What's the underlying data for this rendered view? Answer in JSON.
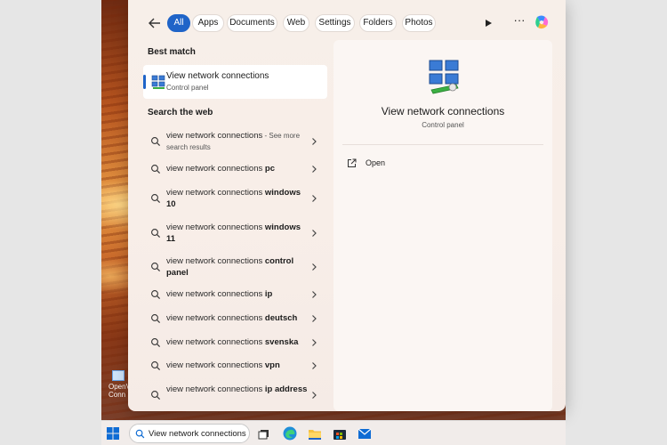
{
  "filters": {
    "back": "back-arrow-icon",
    "chips": [
      {
        "label": "All",
        "active": true
      },
      {
        "label": "Apps"
      },
      {
        "label": "Documents"
      },
      {
        "label": "Web"
      },
      {
        "label": "Settings"
      },
      {
        "label": "Folders"
      },
      {
        "label": "Photos"
      }
    ],
    "more": "···"
  },
  "best_match": {
    "heading": "Best match",
    "title": "View network connections",
    "subtitle": "Control panel"
  },
  "web": {
    "heading": "Search the web",
    "results": [
      {
        "prefix": "view network connections",
        "bold": "",
        "suffix": " - See more search results"
      },
      {
        "prefix": "view network connections ",
        "bold": "pc",
        "suffix": ""
      },
      {
        "prefix": "view network connections ",
        "bold": "windows 10",
        "suffix": ""
      },
      {
        "prefix": "view network connections ",
        "bold": "windows 11",
        "suffix": ""
      },
      {
        "prefix": "view network connections ",
        "bold": "control panel",
        "suffix": ""
      },
      {
        "prefix": "view network connections ",
        "bold": "ip",
        "suffix": ""
      },
      {
        "prefix": "view network connections ",
        "bold": "deutsch",
        "suffix": ""
      },
      {
        "prefix": "view network connections ",
        "bold": "svenska",
        "suffix": ""
      },
      {
        "prefix": "view network connections ",
        "bold": "vpn",
        "suffix": ""
      },
      {
        "prefix": "view network connections ",
        "bold": "ip address",
        "suffix": ""
      }
    ]
  },
  "detail": {
    "title": "View network connections",
    "subtitle": "Control panel",
    "actions": [
      {
        "label": "Open",
        "icon": "open-external-icon"
      }
    ]
  },
  "desktop_icon": {
    "label": "OpenV Conn"
  },
  "taskbar": {
    "search_value": "View network connections",
    "apps": [
      "file-explorer-icon",
      "edge-icon",
      "folder-icon",
      "store-icon",
      "mail-icon"
    ]
  },
  "colors": {
    "accent": "#1f64c8",
    "panel": "#f8eee8",
    "detail": "#fbf6f3"
  }
}
